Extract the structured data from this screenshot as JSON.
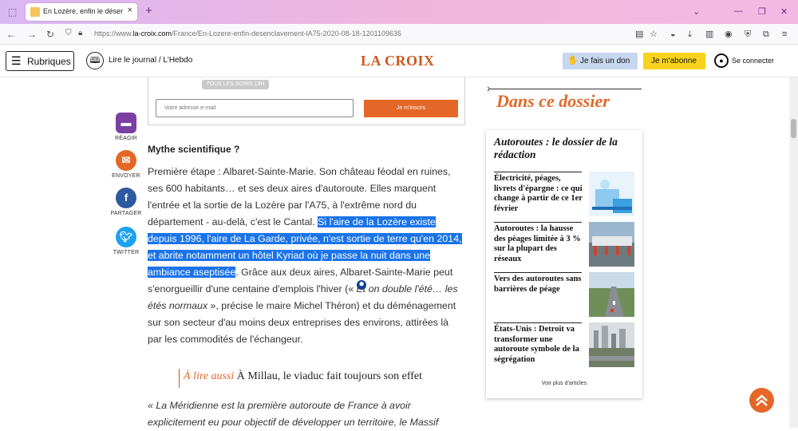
{
  "browser": {
    "tab_title": "En Lozère, enfin le désenclavement",
    "tab_close": "×",
    "new_tab": "+",
    "url_prefix": "https://www.",
    "url_domain": "la-croix.com",
    "url_path": "/France/En-Lozere-enfin-desenclavement-lA75-2020-08-18-1201109635"
  },
  "header": {
    "rubriques_label": "Rubriques",
    "journal_label": "Lire le journal / L'Hebdo",
    "logo": "LA CROIX",
    "don_label": "Je fais un don",
    "abo_label": "Je m'abonne",
    "connect_label": "Se connecter"
  },
  "newsletter": {
    "badge": "TOUS LES SOIRS 19H",
    "email_placeholder": "Votre adresse e-mail",
    "subscribe_label": "Je m'inscris"
  },
  "share": [
    {
      "label": "RÉAGIR",
      "color": "#7b3fa4"
    },
    {
      "label": "ENVOYER",
      "color": "#e46727"
    },
    {
      "label": "PARTAGER",
      "color": "#2d5aa0"
    },
    {
      "label": "TWITTER",
      "color": "#1da1f2"
    }
  ],
  "article": {
    "heading": "Mythe scientifique ?",
    "p1_a": "Première étape : Albaret-Sainte-Marie. Son château féodal en ruines, ses 600 habitants… et ses deux aires d'autoroute. Elles marquent l'entrée et la sortie de la Lozère par l'A75, à l'extrême nord du département - au-delà, c'est le Cantal. ",
    "p1_highlight": "Si l'aire de la Lozère existe depuis 1996, l'aire de La Garde, privée, n'est sortie de terre qu'en 2014, et abrite notamment un hôtel Kyriad où je passe la nuit dans une ambiance aseptisée",
    "p1_b": ". Grâce aux deux aires, Albaret-Sainte-Marie peut s'enorgueillir d'une centaine d'emplois l'hiver (« ",
    "p1_italic": "Et on double l'été… les étés normaux",
    "p1_c": " », précise le maire Michel Théron) et du déménagement sur son secteur d'au moins deux entreprises des environs, attirées là par les commodités de l'échangeur.",
    "lire_aussi_label": "À lire aussi",
    "lire_aussi_text": " À Millau, le viaduc fait toujours son effet",
    "quote": "« La Méridienne est la première autoroute de France à avoir explicitement eu pour objectif de développer un territoire, le Massif"
  },
  "dossier": {
    "title": "Dans ce dossier",
    "head": "Autoroutes : le dossier de la rédaction",
    "items": [
      {
        "text": "Électricité, péages, livrets d'épargne : ce qui change à partir de ce 1er février"
      },
      {
        "text": "Autoroutes : la hausse des péages limitée à 3 % sur la plupart des réseaux"
      },
      {
        "text": "Vers des autoroutes sans barrières de péage"
      },
      {
        "text": "États-Unis : Detroit va transformer une autoroute symbole de la ségrégation"
      }
    ],
    "more": "Voir plus d'articles"
  }
}
